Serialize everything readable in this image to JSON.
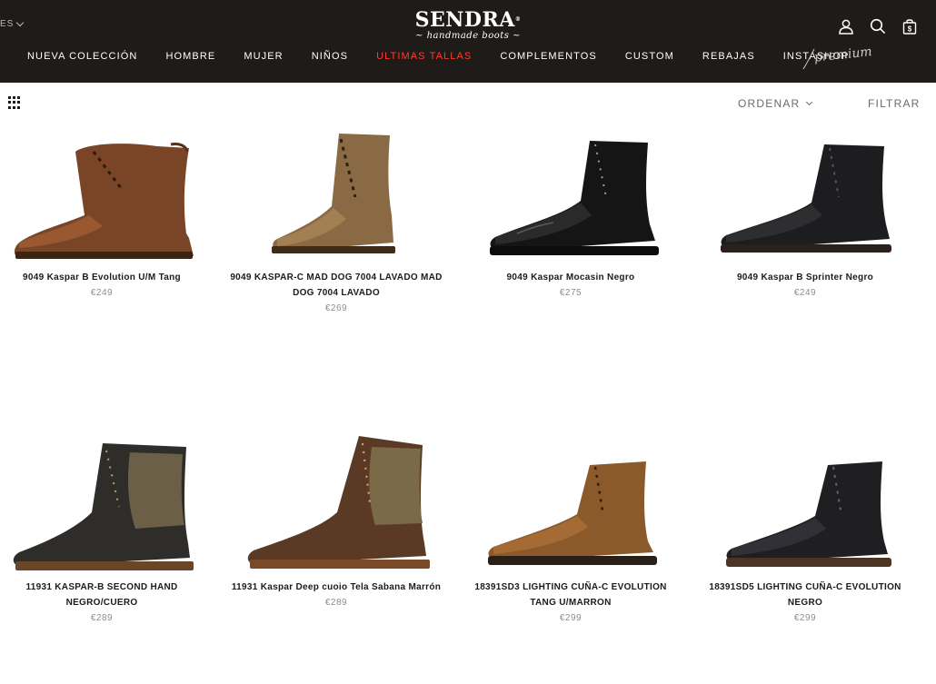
{
  "header": {
    "language": "ES",
    "brand": "SENDRA",
    "brand_mark": "®",
    "tagline": "~ handmade boots ~",
    "premium_label": "premium",
    "nav": [
      {
        "label": "NUEVA COLECCIÓN"
      },
      {
        "label": "HOMBRE"
      },
      {
        "label": "MUJER"
      },
      {
        "label": "NIÑOS"
      },
      {
        "label": "ULTIMAS TALLAS",
        "highlight": true
      },
      {
        "label": "COMPLEMENTOS"
      },
      {
        "label": "CUSTOM"
      },
      {
        "label": "REBAJAS"
      },
      {
        "label": "INSTASHOP"
      }
    ],
    "icons": [
      "account-icon",
      "search-icon",
      "cart-icon"
    ],
    "cart_badge": "$"
  },
  "toolbar": {
    "sort_label": "ORDENAR",
    "filter_label": "FILTRAR",
    "view_icon": "grid-view-icon"
  },
  "colors": {
    "header_bg": "#1e1b19",
    "highlight": "#ff3b2f",
    "price": "#8d8d8d"
  },
  "products": [
    {
      "name": "9049 Kaspar B Evolution U/M Tang",
      "price": "€249",
      "color": "#7a4526"
    },
    {
      "name": "9049 KASPAR-C MAD DOG 7004 LAVADO MAD DOG 7004 LAVADO",
      "price": "€269",
      "color": "#8a6a45"
    },
    {
      "name": "9049 Kaspar Mocasin Negro",
      "price": "€275",
      "color": "#151515"
    },
    {
      "name": "9049 Kaspar B Sprinter Negro",
      "price": "€249",
      "color": "#1d1d1f"
    },
    {
      "name": "11931 KASPAR-B SECOND HAND NEGRO/CUERO",
      "price": "€289",
      "color": "#2e2d29"
    },
    {
      "name": "11931 Kaspar Deep cuoio Tela Sabana Marrón",
      "price": "€289",
      "color": "#5a3a24"
    },
    {
      "name": "18391SD3 LIGHTING CUÑA-C EVOLUTION TANG U/MARRON",
      "price": "€299",
      "color": "#8b5a2b"
    },
    {
      "name": "18391SD5 LIGHTING CUÑA-C EVOLUTION NEGRO",
      "price": "€299",
      "color": "#1f1f22"
    }
  ]
}
